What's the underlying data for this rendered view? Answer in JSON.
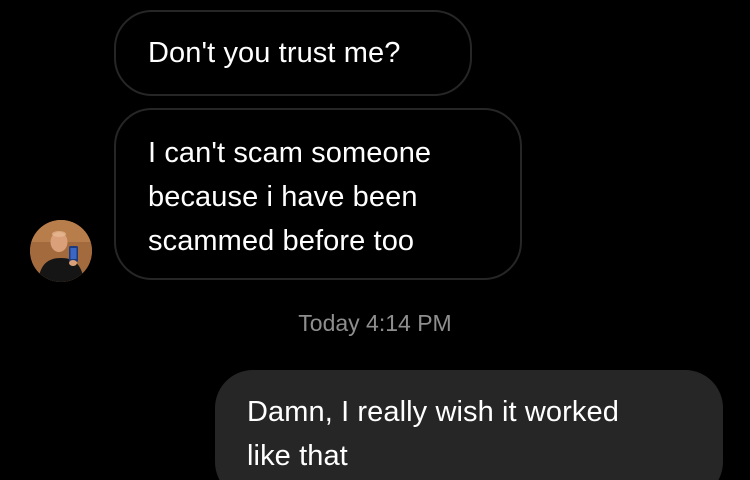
{
  "messages": [
    {
      "direction": "incoming",
      "lines": [
        "Don't you trust me?"
      ]
    },
    {
      "direction": "incoming",
      "lines": [
        "I can't scam someone",
        "because i have been",
        "scammed before too"
      ]
    },
    {
      "direction": "outgoing",
      "lines": [
        "Damn, I really wish it worked",
        "like that"
      ]
    }
  ],
  "timestamp": "Today 4:14 PM",
  "colors": {
    "background": "#000000",
    "incoming_border": "#262626",
    "outgoing_bubble": "#262626",
    "timestamp_text": "#8e8e8e"
  },
  "sender_avatar": {
    "icon": "profile-photo"
  }
}
